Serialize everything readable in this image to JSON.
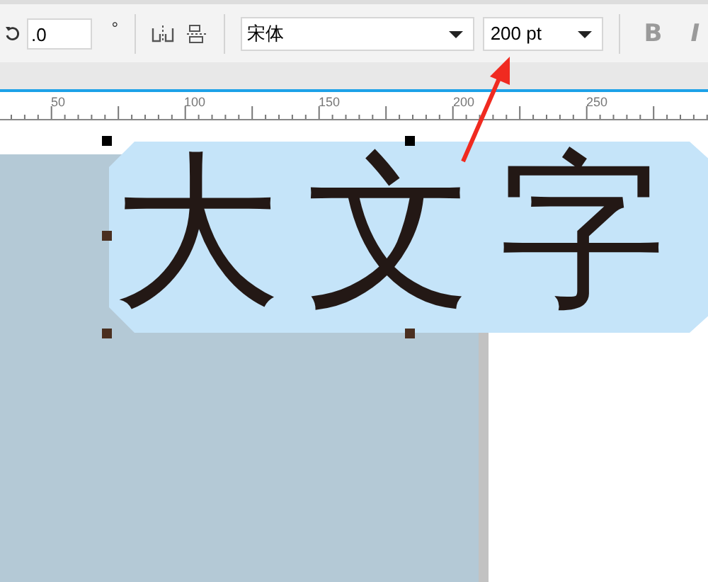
{
  "toolbar": {
    "rotation": {
      "value": ".0",
      "unit": "°"
    },
    "font": {
      "value": "宋体"
    },
    "size": {
      "value": "200 pt"
    },
    "style_buttons": [
      {
        "kind": "bold",
        "label": "B",
        "disabled": true
      },
      {
        "kind": "italic",
        "label": "I",
        "disabled": true
      }
    ]
  },
  "ruler": {
    "labels": [
      "50",
      "100",
      "150",
      "200",
      "250"
    ]
  },
  "canvas": {
    "text": "大文字",
    "selected": true
  }
}
